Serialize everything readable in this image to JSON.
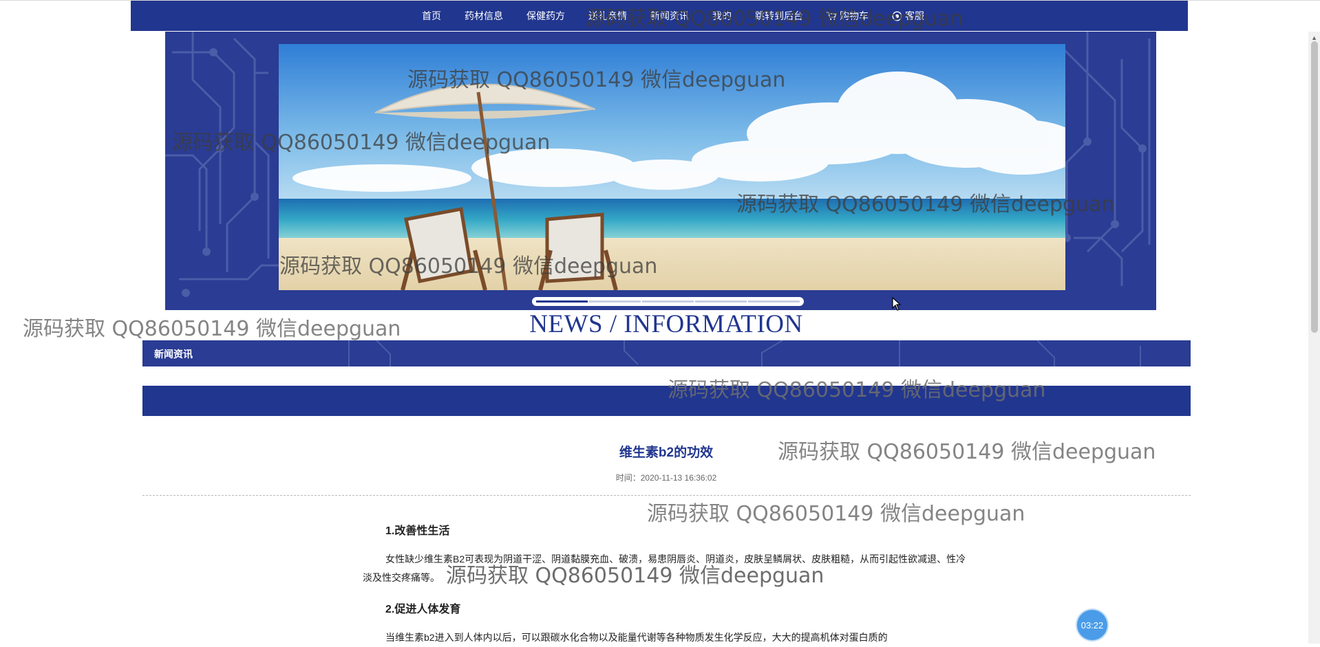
{
  "nav": {
    "items": [
      {
        "label": "首页",
        "icon": ""
      },
      {
        "label": "药材信息",
        "icon": ""
      },
      {
        "label": "保健药方",
        "icon": ""
      },
      {
        "label": "送礼亲情",
        "icon": ""
      },
      {
        "label": "新闻资讯",
        "icon": ""
      },
      {
        "label": "我的",
        "icon": ""
      },
      {
        "label": "跳转到后台",
        "icon": ""
      },
      {
        "label": "购物车",
        "icon": "cart-icon"
      },
      {
        "label": "客服",
        "icon": "support-icon"
      }
    ]
  },
  "banner": {
    "slide_count": 5,
    "active_index": 0
  },
  "news": {
    "english_title": "NEWS / INFORMATION",
    "section_label": "新闻资讯"
  },
  "article": {
    "title": "维生素b2的功效",
    "time_label": "时间：",
    "time_value": "2020-11-13 16:36:02",
    "sections": [
      {
        "heading": "1.改善性生活",
        "body": "女性缺少维生素B2可表现为阴道干涩、阴道黏膜充血、破溃，易患阴唇炎、阴道炎，皮肤呈鳞屑状、皮肤粗糙，从而引起性欲减退、性冷淡及性交疼痛等。"
      },
      {
        "heading": "2.促进人体发育",
        "body": "当维生素b2进入到人体内以后，可以跟碳水化合物以及能量代谢等各种物质发生化学反应，大大的提高机体对蛋白质的"
      }
    ]
  },
  "timer": {
    "value": "03:22"
  },
  "watermark": {
    "text": "源码获取 QQ86050149 微信deepguan"
  },
  "colors": {
    "primary": "#21368f",
    "banner_bg": "#2a3c93",
    "timer": "#4a9ce8"
  }
}
